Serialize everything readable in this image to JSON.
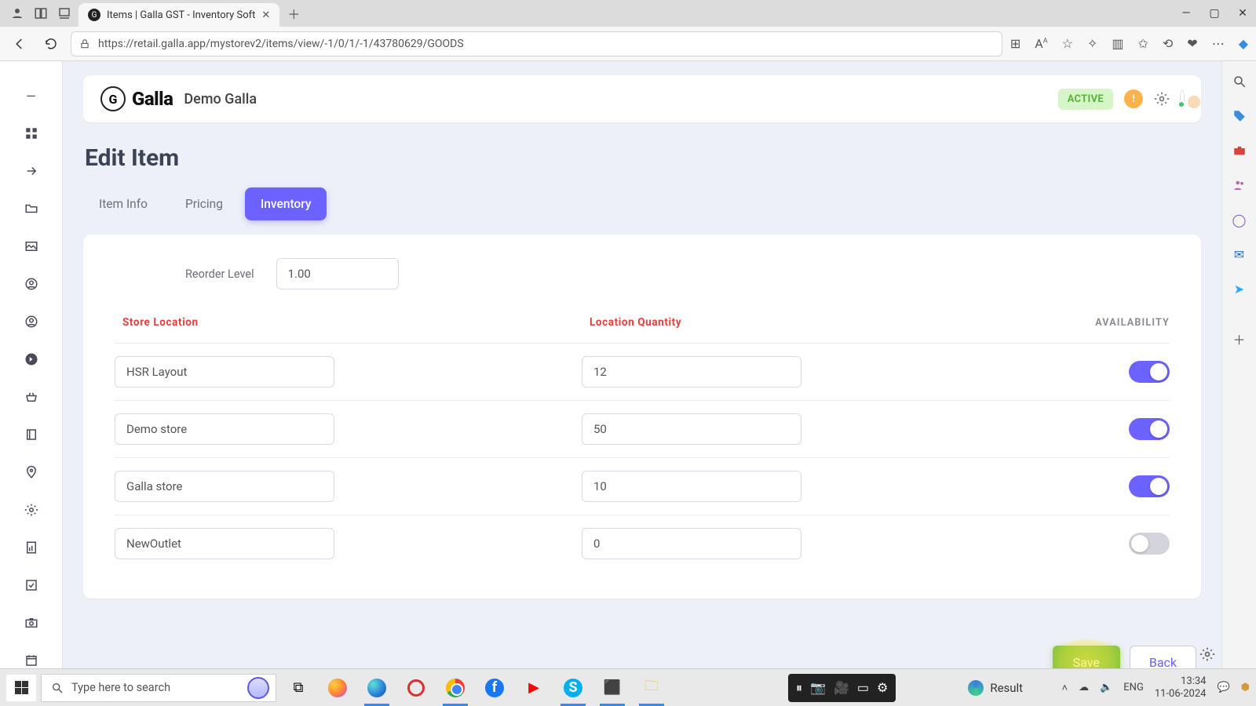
{
  "browser": {
    "tab_title": "Items | Galla GST - Inventory Soft",
    "url": "https://retail.galla.app/mystorev2/items/view/-1/0/1/-1/43780629/GOODS"
  },
  "header": {
    "logo_text": "Galla",
    "org_name": "Demo Galla",
    "status_badge": "ACTIVE"
  },
  "page": {
    "title": "Edit Item",
    "tabs": {
      "info": "Item Info",
      "pricing": "Pricing",
      "inventory": "Inventory"
    }
  },
  "form": {
    "reorder_label": "Reorder Level",
    "reorder_value": "1.00",
    "columns": {
      "location": "Store Location",
      "qty": "Location Quantity",
      "avail": "AVAILABILITY"
    },
    "rows": [
      {
        "location": "HSR Layout",
        "qty": "12",
        "on": true
      },
      {
        "location": "Demo store",
        "qty": "50",
        "on": true
      },
      {
        "location": "Galla store",
        "qty": "10",
        "on": true
      },
      {
        "location": "NewOutlet",
        "qty": "0",
        "on": false
      }
    ],
    "save_label": "Save",
    "back_label": "Back"
  },
  "taskbar": {
    "search_placeholder": "Type here to search",
    "result_label": "Result",
    "lang": "ENG",
    "time": "13:34",
    "date": "11-06-2024"
  }
}
